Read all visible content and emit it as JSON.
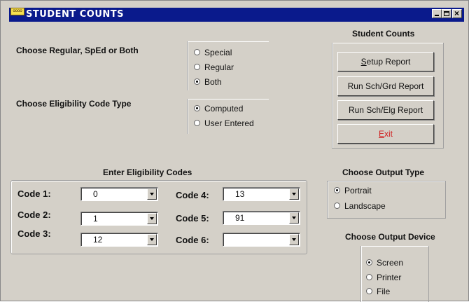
{
  "window": {
    "title": "STUDENT COUNTS",
    "icon_text": "oooo"
  },
  "population": {
    "prompt": "Choose Regular, SpEd or Both",
    "options": [
      {
        "label": "Special",
        "selected": false
      },
      {
        "label": "Regular",
        "selected": false
      },
      {
        "label": "Both",
        "selected": true
      }
    ]
  },
  "eligibility_type": {
    "prompt": "Choose Eligibility Code Type",
    "options": [
      {
        "label": "Computed",
        "selected": true
      },
      {
        "label": "User Entered",
        "selected": false
      }
    ]
  },
  "actions": {
    "heading": "Student Counts",
    "setup_prefix": "S",
    "setup_rest": "etup Report",
    "run_grade": "Run Sch/Grd Report",
    "run_elig": "Run Sch/Elg Report",
    "exit_prefix": "E",
    "exit_rest": "xit"
  },
  "codes": {
    "heading": "Enter Eligibility Codes",
    "fields": [
      {
        "label": "Code 1:",
        "value": "0"
      },
      {
        "label": "Code 2:",
        "value": "1"
      },
      {
        "label": "Code 3:",
        "value": "12"
      },
      {
        "label": "Code 4:",
        "value": "13"
      },
      {
        "label": "Code 5:",
        "value": "91"
      },
      {
        "label": "Code 6:",
        "value": ""
      }
    ]
  },
  "output_type": {
    "heading": "Choose Output Type",
    "options": [
      {
        "label": "Portrait",
        "selected": true
      },
      {
        "label": "Landscape",
        "selected": false
      }
    ]
  },
  "output_device": {
    "heading": "Choose Output Device",
    "options": [
      {
        "label": "Screen",
        "selected": true
      },
      {
        "label": "Printer",
        "selected": false
      },
      {
        "label": "File",
        "selected": false
      }
    ]
  }
}
